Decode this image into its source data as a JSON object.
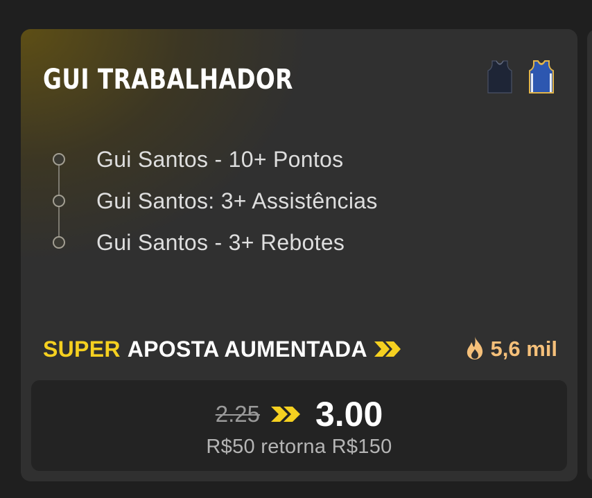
{
  "card": {
    "title": "GUI TRABALHADOR",
    "home_jersey_icon": "dark-navy-jersey",
    "away_jersey_icon": "blue-gold-jersey",
    "legs": [
      {
        "label": "Gui Santos - 10+ Pontos"
      },
      {
        "label": "Gui Santos: 3+ Assistências"
      },
      {
        "label": "Gui Santos - 3+ Rebotes"
      }
    ],
    "boost": {
      "prefix": "SUPER",
      "label": "APOSTA AUMENTADA",
      "arrows_icon": "chevrons-right-icon",
      "popularity_icon": "fire-icon",
      "popularity_count": "5,6 mil"
    },
    "odds": {
      "old": "2.25",
      "new": "3.00",
      "returns": "R$50 retorna R$150"
    }
  },
  "colors": {
    "accent_yellow": "#f5d020",
    "popularity_orange": "#f5c07a",
    "card_bg": "#303030",
    "odds_box_bg": "#232323"
  }
}
